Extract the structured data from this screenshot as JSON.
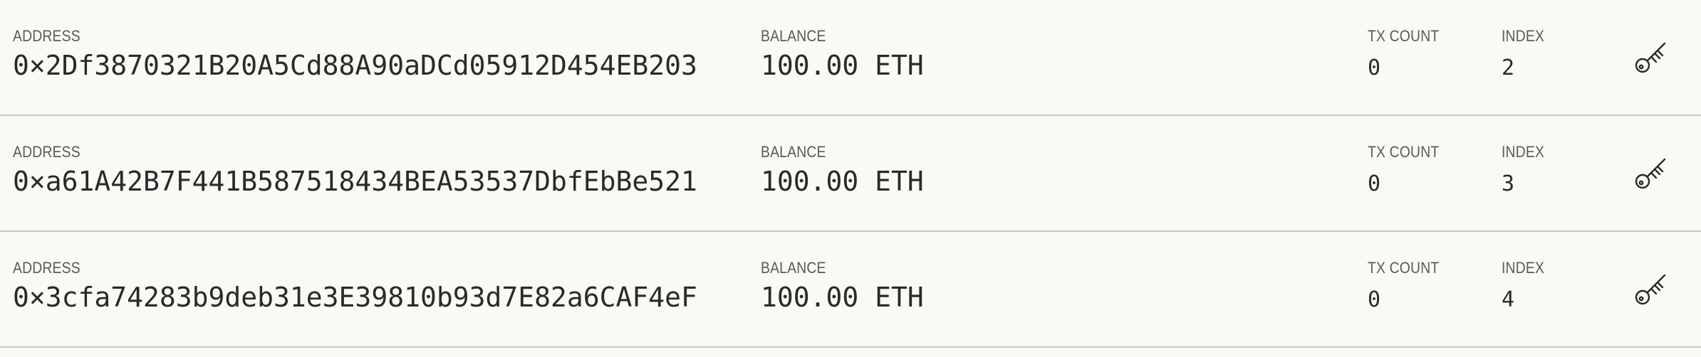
{
  "labels": {
    "address": "ADDRESS",
    "balance": "BALANCE",
    "tx_count": "TX COUNT",
    "index": "INDEX"
  },
  "accounts": [
    {
      "address": "0×2Df3870321B20A5Cd88A90aDCd05912D454EB203",
      "balance": "100.00 ETH",
      "tx_count": "0",
      "index": "2",
      "icon": "key-icon"
    },
    {
      "address": "0×a61A42B7F441B587518434BEA53537DbfEbBe521",
      "balance": "100.00 ETH",
      "tx_count": "0",
      "index": "3",
      "icon": "key-icon"
    },
    {
      "address": "0×3cfa74283b9deb31e3E39810b93d7E82a6CAF4eF",
      "balance": "100.00 ETH",
      "tx_count": "0",
      "index": "4",
      "icon": "key-icon"
    }
  ],
  "colors": {
    "background": "#faf9f6",
    "divider": "#c9c8c4",
    "label": "#5a5a57",
    "value": "#2b2a29"
  }
}
